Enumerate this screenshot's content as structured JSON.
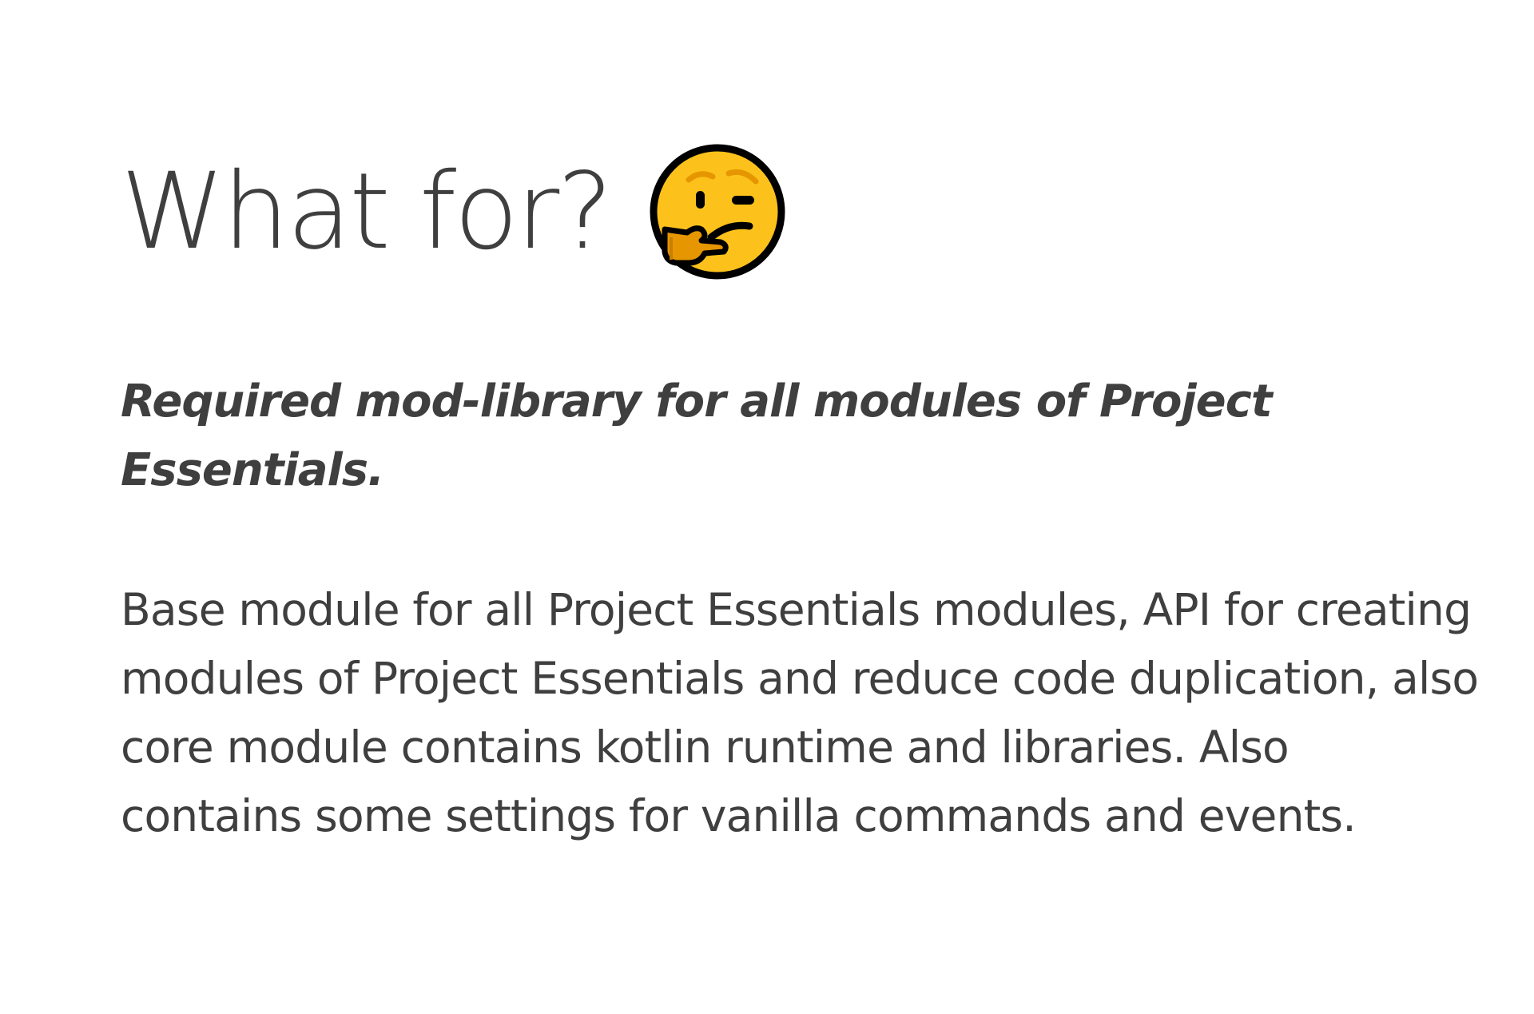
{
  "heading": {
    "title": "What for?",
    "emoji": "thinking-face-icon"
  },
  "tagline": "Required mod-library for all modules of Project Essentials.",
  "description": "Base module for all Project Essentials modules, API for creating modules of Project Essentials and reduce code duplication, also core module contains kotlin runtime and libraries. Also contains some settings for vanilla commands and events.",
  "colors": {
    "text": "#3f3f3f",
    "background": "#ffffff",
    "emoji_face": "#fcc21b",
    "emoji_hand": "#e59600"
  }
}
